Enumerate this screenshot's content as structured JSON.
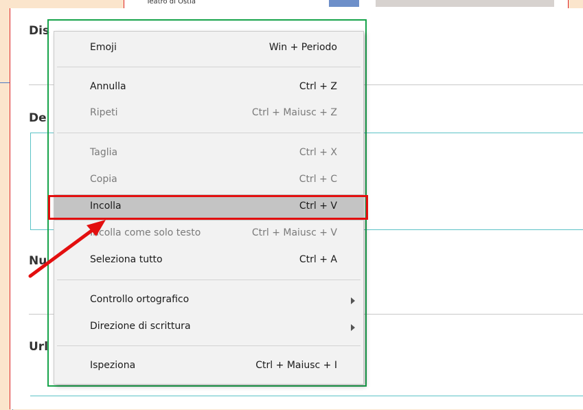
{
  "top": {
    "place_label": "Teatro di Ostia"
  },
  "headings": {
    "h1": "Dis",
    "h2": "De",
    "h3": "Nu",
    "h4": "Url"
  },
  "menu": {
    "items": [
      {
        "label": "Emoji",
        "shortcut": "Win + Periodo",
        "disabled": false
      },
      {
        "label": "Annulla",
        "shortcut": "Ctrl + Z",
        "disabled": false
      },
      {
        "label": "Ripeti",
        "shortcut": "Ctrl + Maiusc + Z",
        "disabled": true
      },
      {
        "label": "Taglia",
        "shortcut": "Ctrl + X",
        "disabled": true
      },
      {
        "label": "Copia",
        "shortcut": "Ctrl + C",
        "disabled": true
      },
      {
        "label": "Incolla",
        "shortcut": "Ctrl + V",
        "disabled": false,
        "highlighted": true
      },
      {
        "label": "Incolla come solo testo",
        "shortcut": "Ctrl + Maiusc + V",
        "disabled": true
      },
      {
        "label": "Seleziona tutto",
        "shortcut": "Ctrl + A",
        "disabled": true
      },
      {
        "label": "Controllo ortografico",
        "shortcut": "",
        "submenu": true
      },
      {
        "label": "Direzione di scrittura",
        "shortcut": "",
        "submenu": true
      },
      {
        "label": "Ispeziona",
        "shortcut": "Ctrl + Maiusc + I",
        "disabled": false
      }
    ]
  },
  "colors": {
    "background": "#fbe5cc",
    "menu_bg": "#f2f2f2",
    "highlight": "#c4c4c4",
    "annotation_red": "#e30f0f",
    "annotation_green": "#16a34a",
    "teal": "#5ac2c6"
  },
  "icons": {
    "submenu_arrow": "chevron-right-icon",
    "annotation_arrow": "red-arrow-pointer"
  }
}
